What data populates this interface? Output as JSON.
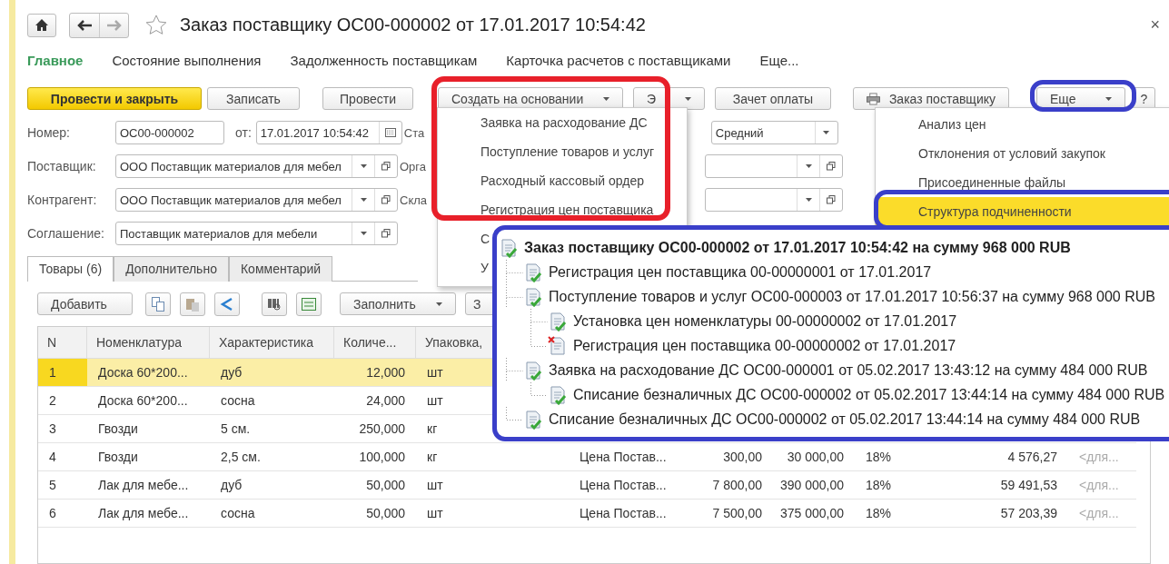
{
  "window": {
    "title": "Заказ поставщику ОС00-000002 от 17.01.2017 10:54:42",
    "favorite": false,
    "close": "×"
  },
  "nav": [
    {
      "label": "Главное",
      "selected": true
    },
    {
      "label": "Состояние выполнения",
      "selected": false
    },
    {
      "label": "Задолженность поставщикам",
      "selected": false
    },
    {
      "label": "Карточка расчетов с поставщиками",
      "selected": false
    },
    {
      "label": "Еще...",
      "selected": false
    }
  ],
  "toolbar": [
    {
      "label": "Провести и закрыть",
      "kind": "primary"
    },
    {
      "label": "Записать",
      "kind": "plain"
    },
    {
      "label": "Провести",
      "kind": "plain"
    },
    {
      "label": "Создать на основании",
      "kind": "dropdown"
    },
    {
      "label": "Э",
      "kind": "dropdown"
    },
    {
      "label": "Зачет оплаты",
      "kind": "plain"
    },
    {
      "label": "Заказ поставщику",
      "kind": "print"
    },
    {
      "label": "Еще",
      "kind": "dropdown"
    },
    {
      "label": "?",
      "kind": "plain"
    }
  ],
  "form": {
    "number": {
      "label": "Номер:",
      "value": "ОС00-000002"
    },
    "date": {
      "label": "от:",
      "value": "17.01.2017 10:54:42"
    },
    "fields": [
      {
        "label": "Поставщик:",
        "value": "ООО Поставщик материалов для мебел"
      },
      {
        "label": "Контрагент:",
        "value": "ООО Поставщик материалов для мебел"
      },
      {
        "label": "Соглашение:",
        "value": "Поставщик материалов для мебели"
      }
    ],
    "side": [
      {
        "label": "Ста",
        "value": "Средний",
        "open": false
      },
      {
        "label": "Орга",
        "open": true
      },
      {
        "label": "Скла",
        "open": true
      }
    ]
  },
  "tabs": [
    {
      "label": "Товары (6)",
      "selected": true
    },
    {
      "label": "Дополнительно",
      "selected": false
    },
    {
      "label": "Комментарий",
      "selected": false
    }
  ],
  "table_toolbar": {
    "add": "Добавить",
    "fill": "Заполнить",
    "next": "З"
  },
  "table": {
    "columns": [
      "N",
      "Номенклатура",
      "Характеристика",
      "Количе...",
      "Упаковка,"
    ],
    "rows": [
      {
        "selected": true,
        "cells": [
          "1",
          "Доска 60*200...",
          "дуб",
          "12,000",
          "шт"
        ]
      },
      {
        "selected": false,
        "cells": [
          "2",
          "Доска 60*200...",
          "сосна",
          "24,000",
          "шт"
        ]
      },
      {
        "selected": false,
        "cells": [
          "3",
          "Гвозди",
          "5 см.",
          "250,000",
          "кг"
        ]
      },
      {
        "selected": false,
        "cells": [
          "4",
          "Гвозди",
          "2,5 см.",
          "100,000",
          "кг",
          "Цена Постав...",
          "300,00",
          "30 000,00",
          "18%",
          "4 576,27",
          "<для..."
        ]
      },
      {
        "selected": false,
        "cells": [
          "5",
          "Лак для мебе...",
          "дуб",
          "50,000",
          "шт",
          "Цена Постав...",
          "7 800,00",
          "390 000,00",
          "18%",
          "59 491,53",
          "<для..."
        ]
      },
      {
        "selected": false,
        "cells": [
          "6",
          "Лак для мебе...",
          "сосна",
          "50,000",
          "шт",
          "Цена Постав...",
          "7 500,00",
          "375 000,00",
          "18%",
          "57 203,39",
          "<для..."
        ]
      }
    ]
  },
  "basis_menu": {
    "items": [
      "Заявка на расходование ДС",
      "Поступление товаров и услуг",
      "Расходный кассовый ордер",
      "Регистрация цен поставщика",
      "С",
      "У"
    ]
  },
  "more_menu": {
    "items": [
      {
        "label": "Анализ цен",
        "selected": false
      },
      {
        "label": "Отклонения от условий закупок",
        "selected": false
      },
      {
        "label": "Присоединенные файлы",
        "selected": false
      },
      {
        "label": "Структура подчиненности",
        "selected": true
      }
    ]
  },
  "structure": {
    "root": {
      "text": "Заказ поставщику ОС00-000002 от 17.01.2017 10:54:42 на сумму 968 000 RUB",
      "kind": "posted",
      "children": [
        {
          "text": "Регистрация цен поставщика 00-00000001 от 17.01.2017",
          "kind": "posted"
        },
        {
          "text": "Поступление товаров и услуг ОС00-000003 от 17.01.2017 10:56:37 на сумму 968 000 RUB",
          "kind": "posted",
          "children": [
            {
              "text": "Установка цен номенклатуры 00-00000002 от 17.01.2017",
              "kind": "posted"
            },
            {
              "text": "Регистрация цен поставщика 00-00000002 от 17.01.2017",
              "kind": "deleted"
            }
          ]
        },
        {
          "text": "Заявка на расходование ДС ОС00-000001 от 05.02.2017 13:43:12 на сумму 484 000 RUB",
          "kind": "posted",
          "children": [
            {
              "text": "Списание безналичных ДС ОС00-000002 от 05.02.2017 13:44:14 на сумму 484 000 RUB",
              "kind": "posted"
            }
          ]
        },
        {
          "text": "Списание безналичных ДС ОС00-000002 от 05.02.2017 13:44:14 на сумму 484 000 RUB",
          "kind": "posted"
        }
      ]
    }
  }
}
